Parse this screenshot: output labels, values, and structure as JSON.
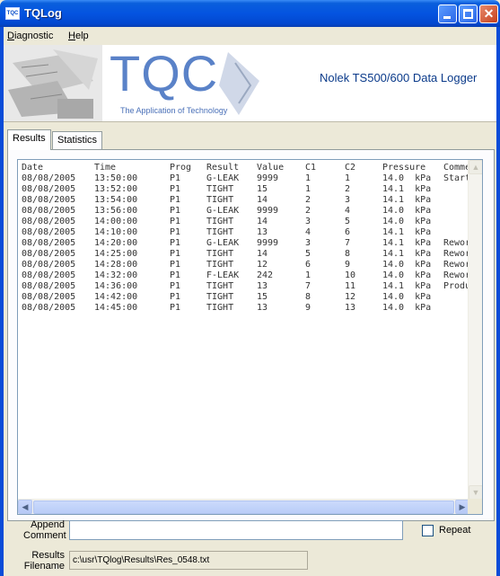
{
  "window": {
    "title": "TQLog",
    "app_icon_text": "TQC"
  },
  "menu": {
    "items": [
      {
        "label": "Diagnostic",
        "accel": "D",
        "rest": "iagnostic"
      },
      {
        "label": "Help",
        "accel": "H",
        "rest": "elp"
      }
    ]
  },
  "banner": {
    "logo": "TQC",
    "tagline": "The Application of Technology",
    "title": "Nolek TS500/600 Data Logger"
  },
  "tabs": [
    {
      "label": "Results",
      "active": true
    },
    {
      "label": "Statistics",
      "active": false
    }
  ],
  "results": {
    "columns": [
      "Date",
      "Time",
      "Prog",
      "Result",
      "Value",
      "C1",
      "C2",
      "Pressure",
      "Comme"
    ],
    "rows": [
      [
        "08/08/2005",
        "13:50:00",
        "P1",
        "G-LEAK",
        "9999",
        "1",
        "1",
        "14.0  kPa",
        "Start"
      ],
      [
        "08/08/2005",
        "13:52:00",
        "P1",
        "TIGHT",
        "15",
        "1",
        "2",
        "14.1  kPa",
        ""
      ],
      [
        "08/08/2005",
        "13:54:00",
        "P1",
        "TIGHT",
        "14",
        "2",
        "3",
        "14.1  kPa",
        ""
      ],
      [
        "08/08/2005",
        "13:56:00",
        "P1",
        "G-LEAK",
        "9999",
        "2",
        "4",
        "14.0  kPa",
        ""
      ],
      [
        "08/08/2005",
        "14:00:00",
        "P1",
        "TIGHT",
        "14",
        "3",
        "5",
        "14.0  kPa",
        ""
      ],
      [
        "08/08/2005",
        "14:10:00",
        "P1",
        "TIGHT",
        "13",
        "4",
        "6",
        "14.1  kPa",
        ""
      ],
      [
        "08/08/2005",
        "14:20:00",
        "P1",
        "G-LEAK",
        "9999",
        "3",
        "7",
        "14.1  kPa",
        "Rewor"
      ],
      [
        "08/08/2005",
        "14:25:00",
        "P1",
        "TIGHT",
        "14",
        "5",
        "8",
        "14.1  kPa",
        "Rewor"
      ],
      [
        "08/08/2005",
        "14:28:00",
        "P1",
        "TIGHT",
        "12",
        "6",
        "9",
        "14.0  kPa",
        "Rewor"
      ],
      [
        "08/08/2005",
        "14:32:00",
        "P1",
        "F-LEAK",
        "242",
        "1",
        "10",
        "14.0  kPa",
        "Rewor"
      ],
      [
        "08/08/2005",
        "14:36:00",
        "P1",
        "TIGHT",
        "13",
        "7",
        "11",
        "14.1  kPa",
        "Produ"
      ],
      [
        "08/08/2005",
        "14:42:00",
        "P1",
        "TIGHT",
        "15",
        "8",
        "12",
        "14.0  kPa",
        ""
      ],
      [
        "08/08/2005",
        "14:45:00",
        "P1",
        "TIGHT",
        "13",
        "9",
        "13",
        "14.0  kPa",
        ""
      ]
    ]
  },
  "comment": {
    "label_line1": "Append",
    "label_line2": "Comment",
    "value": "",
    "repeat_label": "Repeat",
    "repeat_checked": false
  },
  "filename": {
    "label_line1": "Results",
    "label_line2": "Filename",
    "value": "c:\\usr\\TQlog\\Results\\Res_0548.txt"
  },
  "colors": {
    "titlebar": "#0454e0",
    "logo": "#5a82c8",
    "banner_title": "#0a3a8a"
  }
}
